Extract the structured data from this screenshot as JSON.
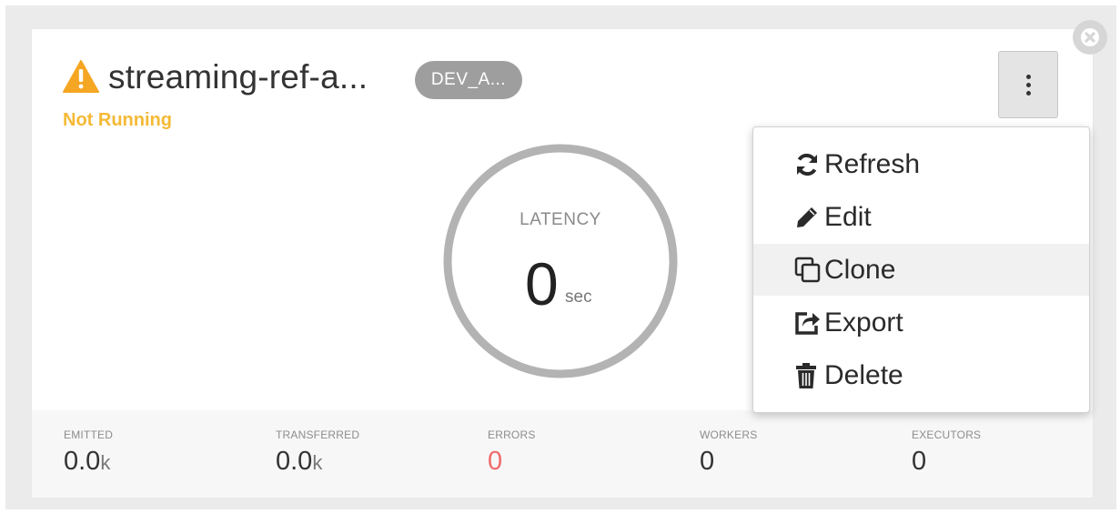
{
  "card": {
    "title": "streaming-ref-a...",
    "badge": "DEV_A...",
    "status": "Not Running",
    "status_color": "#f5b935",
    "warning_icon": "warning-triangle-icon",
    "close_icon": "close-circle-icon",
    "menu_icon": "vertical-ellipsis-icon"
  },
  "gauge": {
    "label": "LATENCY",
    "value": "0",
    "unit": "sec"
  },
  "metrics": [
    {
      "label": "EMITTED",
      "value": "0.0",
      "suffix": "k"
    },
    {
      "label": "TRANSFERRED",
      "value": "0.0",
      "suffix": "k"
    },
    {
      "label": "ERRORS",
      "value": "0",
      "suffix": ""
    },
    {
      "label": "WORKERS",
      "value": "0",
      "suffix": ""
    },
    {
      "label": "EXECUTORS",
      "value": "0",
      "suffix": ""
    }
  ],
  "menu": {
    "items": [
      {
        "label": "Refresh",
        "icon": "refresh-icon"
      },
      {
        "label": "Edit",
        "icon": "pencil-icon"
      },
      {
        "label": "Clone",
        "icon": "clone-icon"
      },
      {
        "label": "Export",
        "icon": "export-icon"
      },
      {
        "label": "Delete",
        "icon": "trash-icon"
      }
    ],
    "highlighted": "Clone"
  },
  "colors": {
    "error": "#ef6b6b",
    "gauge_ring": "#b3b3b3",
    "badge_bg": "#9e9e9e"
  }
}
